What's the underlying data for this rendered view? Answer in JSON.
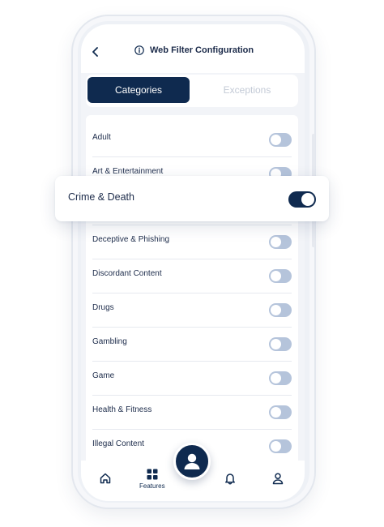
{
  "header": {
    "title": "Web Filter Configuration",
    "back_icon": "chevron-left-icon",
    "info_icon": "info-icon"
  },
  "tabs": [
    {
      "label": "Categories",
      "active": true
    },
    {
      "label": "Exceptions",
      "active": false
    }
  ],
  "categories": [
    {
      "label": "Adult",
      "enabled": false
    },
    {
      "label": "Art & Entertainment",
      "enabled": false
    },
    {
      "label": "Crime & Death",
      "enabled": true
    },
    {
      "label": "Deceptive & Phishing",
      "enabled": false
    },
    {
      "label": "Discordant Content",
      "enabled": false
    },
    {
      "label": "Drugs",
      "enabled": false
    },
    {
      "label": "Gambling",
      "enabled": false
    },
    {
      "label": "Game",
      "enabled": false
    },
    {
      "label": "Health & Fitness",
      "enabled": false
    },
    {
      "label": "Illegal Content",
      "enabled": false
    }
  ],
  "bottom_nav": {
    "home_icon": "home-icon",
    "features_label": "Features",
    "features_icon": "grid-icon",
    "bell_icon": "bell-icon",
    "user_icon": "user-icon",
    "avatar_icon": "avatar-icon"
  },
  "colors": {
    "primary": "#0f2a4f",
    "toggle_off": "#b5c4db",
    "background": "#f2f4f8"
  }
}
